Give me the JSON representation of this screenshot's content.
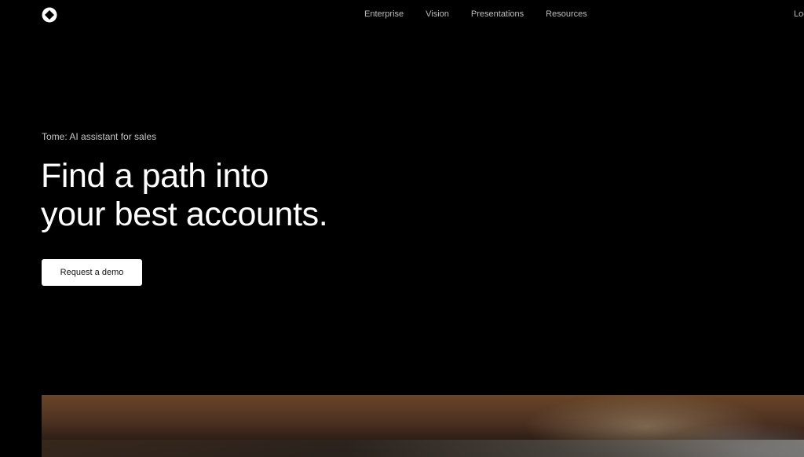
{
  "nav": {
    "logo_icon": "tome-logo-icon",
    "links": [
      "Enterprise",
      "Vision",
      "Presentations",
      "Resources"
    ],
    "login": "Log"
  },
  "hero": {
    "eyebrow": "Tome: AI assistant for sales",
    "headline_line1": "Find a path into",
    "headline_line2": "your best accounts.",
    "cta_label": "Request a demo"
  },
  "colors": {
    "background": "#000000",
    "text": "#ffffff",
    "nav_text": "#bdbdbd",
    "cta_background": "#ffffff"
  }
}
